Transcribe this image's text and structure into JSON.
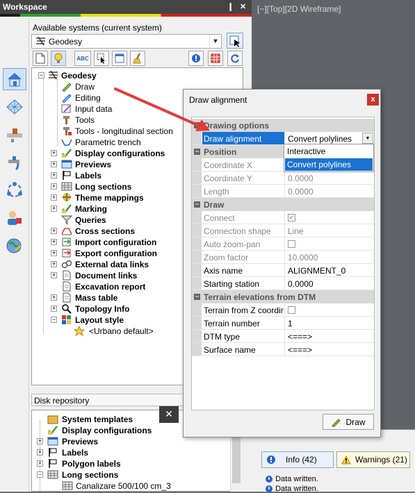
{
  "workspace": {
    "title": "Workspace",
    "pin_label": "❙",
    "close_label": "✕",
    "available_label": "Available systems (current system)",
    "system_value": "Geodesy",
    "toolbar": [
      "new-icon",
      "bulb-icon",
      "abc-icon",
      "select-icon",
      "window-icon",
      "broom-icon",
      "info-icon",
      "grid-icon",
      "refresh-icon"
    ]
  },
  "tree": {
    "root": "Geodesy",
    "tools": [
      "Draw",
      "Editing",
      "Input data",
      "Tools",
      "Tools - longitudinal section",
      "Parametric trench"
    ],
    "groups": [
      "Display configurations",
      "Previews",
      "Labels",
      "Long sections",
      "Theme mappings",
      "Marking",
      "Queries",
      "Cross sections",
      "Import configuration",
      "Export configuration",
      "External data links",
      "Document links",
      "Excavation report",
      "Mass table",
      "Topology Info",
      "Layout style"
    ],
    "layout_child": "<Urbano default>"
  },
  "disk": {
    "label": "Disk repository",
    "items": [
      "System templates",
      "Display configurations",
      "Previews",
      "Labels",
      "Polygon labels",
      "Long sections"
    ],
    "child": "Canalizare 500/100 cm_3"
  },
  "viewport": {
    "label": "[−][Top][2D Wireframe]"
  },
  "messages": {
    "info_tab": "Info (42)",
    "warn_tab": "Warnings (21)",
    "lines": [
      "Data written.",
      "Data written."
    ]
  },
  "dialog": {
    "title": "Draw alignment",
    "close": "x",
    "sections": {
      "drawing": "Drawing options",
      "position": "Position",
      "draw": "Draw",
      "terrain": "Terrain elevations from DTM"
    },
    "rows": {
      "draw_alignment": {
        "name": "Draw alignment",
        "value": "Convert polylines"
      },
      "coord_x": {
        "name": "Coordinate X",
        "value": ""
      },
      "coord_y": {
        "name": "Coordinate Y",
        "value": "0.0000"
      },
      "length": {
        "name": "Length",
        "value": "0.0000"
      },
      "connect": {
        "name": "Connect",
        "value": "✔"
      },
      "conn_shape": {
        "name": "Connection shape",
        "value": "Line"
      },
      "auto_zoom": {
        "name": "Auto zoom-pan",
        "value": ""
      },
      "zoom_factor": {
        "name": "Zoom factor",
        "value": "10.0000"
      },
      "axis_name": {
        "name": "Axis name",
        "value": "ALIGNMENT_0"
      },
      "start_station": {
        "name": "Starting station",
        "value": "0.0000"
      },
      "terrain_z": {
        "name": "Terrain from Z coordin",
        "value": ""
      },
      "terrain_num": {
        "name": "Terrain number",
        "value": "1"
      },
      "dtm_type": {
        "name": "DTM type",
        "value": "<===>"
      },
      "surface_name": {
        "name": "Surface name",
        "value": "<===>"
      }
    },
    "dropdown_options": [
      "Interactive",
      "Convert polylines"
    ],
    "draw_button": "Draw"
  },
  "colors": {
    "accent": "#1b72d1",
    "arrow": "#e53a3a"
  }
}
